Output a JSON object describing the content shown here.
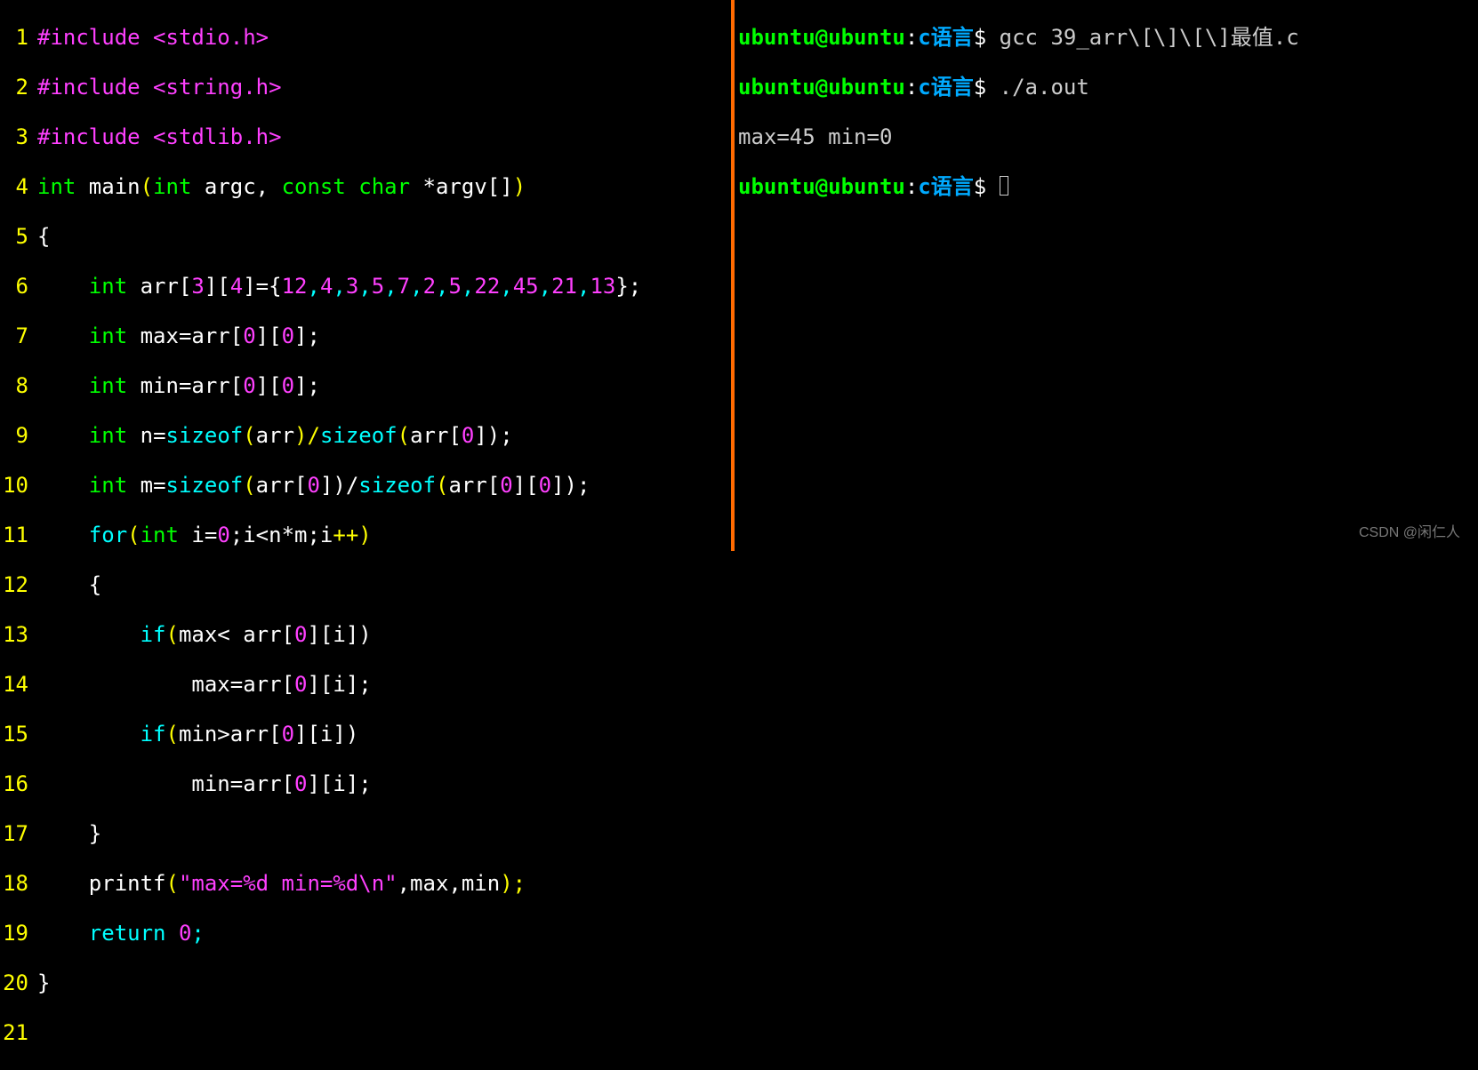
{
  "editor": {
    "lines": {
      "l1_a": "#include ",
      "l1_b": "<stdio.h>",
      "l2_a": "#include ",
      "l2_b": "<string.h>",
      "l3_a": "#include ",
      "l3_b": "<stdlib.h>",
      "l4_a": "int",
      "l4_b": " main",
      "l4_c": "(",
      "l4_d": "int",
      "l4_e": " argc, ",
      "l4_f": "const",
      "l4_g": " ",
      "l4_h": "char",
      "l4_i": " *argv",
      "l4_j": "[]",
      "l4_k": ")",
      "l5": "{",
      "l6_a": "    ",
      "l6_b": "int",
      "l6_c": " arr",
      "l6_d": "[",
      "l6_e": "3",
      "l6_f": "][",
      "l6_g": "4",
      "l6_h": "]",
      "l6_i": "=",
      "l6_j": "{",
      "l6_k": "12",
      "l6_l": ",",
      "l6_m": "4",
      "l6_n": ",",
      "l6_o": "3",
      "l6_p": ",",
      "l6_q": "5",
      "l6_r": ",",
      "l6_s": "7",
      "l6_t": ",",
      "l6_u": "2",
      "l6_v": ",",
      "l6_w": "5",
      "l6_x": ",",
      "l6_y": "22",
      "l6_z": ",",
      "l6_A": "45",
      "l6_B": ",",
      "l6_C": "21",
      "l6_D": ",",
      "l6_E": "13",
      "l6_F": "};",
      "l7_a": "    ",
      "l7_b": "int",
      "l7_c": " max",
      "l7_d": "=",
      "l7_e": "arr",
      "l7_f": "[",
      "l7_g": "0",
      "l7_h": "][",
      "l7_i": "0",
      "l7_j": "];",
      "l8_a": "    ",
      "l8_b": "int",
      "l8_c": " min",
      "l8_d": "=",
      "l8_e": "arr",
      "l8_f": "[",
      "l8_g": "0",
      "l8_h": "][",
      "l8_i": "0",
      "l8_j": "];",
      "l9_a": "    ",
      "l9_b": "int",
      "l9_c": " n",
      "l9_d": "=",
      "l9_e": "sizeof",
      "l9_f": "(",
      "l9_g": "arr",
      "l9_h": ")/",
      "l9_i": "sizeof",
      "l9_j": "(",
      "l9_k": "arr",
      "l9_l": "[",
      "l9_m": "0",
      "l9_n": "]);",
      "l10_a": "    ",
      "l10_b": "int",
      "l10_c": " m",
      "l10_d": "=",
      "l10_e": "sizeof",
      "l10_f": "(",
      "l10_g": "arr",
      "l10_h": "[",
      "l10_i": "0",
      "l10_j": "])/",
      "l10_k": "sizeof",
      "l10_l": "(",
      "l10_m": "arr",
      "l10_n": "[",
      "l10_o": "0",
      "l10_p": "][",
      "l10_q": "0",
      "l10_r": "]);",
      "l11_a": "    ",
      "l11_b": "for",
      "l11_c": "(",
      "l11_d": "int",
      "l11_e": " i",
      "l11_f": "=",
      "l11_g": "0",
      "l11_h": ";i<n*m;i",
      "l11_i": "++)",
      "l12": "    {",
      "l13_a": "        ",
      "l13_b": "if",
      "l13_c": "(",
      "l13_d": "max< arr",
      "l13_e": "[",
      "l13_f": "0",
      "l13_g": "][",
      "l13_h": "i",
      "l13_i": "])",
      "l14_a": "            max",
      "l14_b": "=",
      "l14_c": "arr",
      "l14_d": "[",
      "l14_e": "0",
      "l14_f": "][",
      "l14_g": "i",
      "l14_h": "];",
      "l15_a": "        ",
      "l15_b": "if",
      "l15_c": "(",
      "l15_d": "min>arr",
      "l15_e": "[",
      "l15_f": "0",
      "l15_g": "][",
      "l15_h": "i",
      "l15_i": "])",
      "l16_a": "            min",
      "l16_b": "=",
      "l16_c": "arr",
      "l16_d": "[",
      "l16_e": "0",
      "l16_f": "][",
      "l16_g": "i",
      "l16_h": "];",
      "l17": "    }",
      "l18_a": "    printf",
      "l18_b": "(",
      "l18_c": "\"max=%d min=%d\\n\"",
      "l18_d": ",max,min",
      "l18_e": ");",
      "l19_a": "    ",
      "l19_b": "return",
      "l19_c": " ",
      "l19_d": "0",
      "l19_e": ";",
      "l20": "}",
      "l21": ""
    },
    "nums": {
      "n1": "1",
      "n2": "2",
      "n3": "3",
      "n4": "4",
      "n5": "5",
      "n6": "6",
      "n7": "7",
      "n8": "8",
      "n9": "9",
      "n10": "10",
      "n11": "11",
      "n12": "12",
      "n13": "13",
      "n14": "14",
      "n15": "15",
      "n16": "16",
      "n17": "17",
      "n18": "18",
      "n19": "19",
      "n20": "20",
      "n21": "21"
    }
  },
  "terminal": {
    "p1_user": "ubuntu@ubuntu",
    "p1_colon": ":",
    "p1_path": "c语言",
    "p1_d": "$ ",
    "p1_cmd": "gcc 39_arr\\[\\]\\[\\]最值.c",
    "p2_user": "ubuntu@ubuntu",
    "p2_colon": ":",
    "p2_path": "c语言",
    "p2_d": "$ ",
    "p2_cmd": "./a.out",
    "out1": "max=45 min=0",
    "p3_user": "ubuntu@ubuntu",
    "p3_colon": ":",
    "p3_path": "c语言",
    "p3_d": "$ "
  },
  "watermark": "CSDN @闲仁人"
}
